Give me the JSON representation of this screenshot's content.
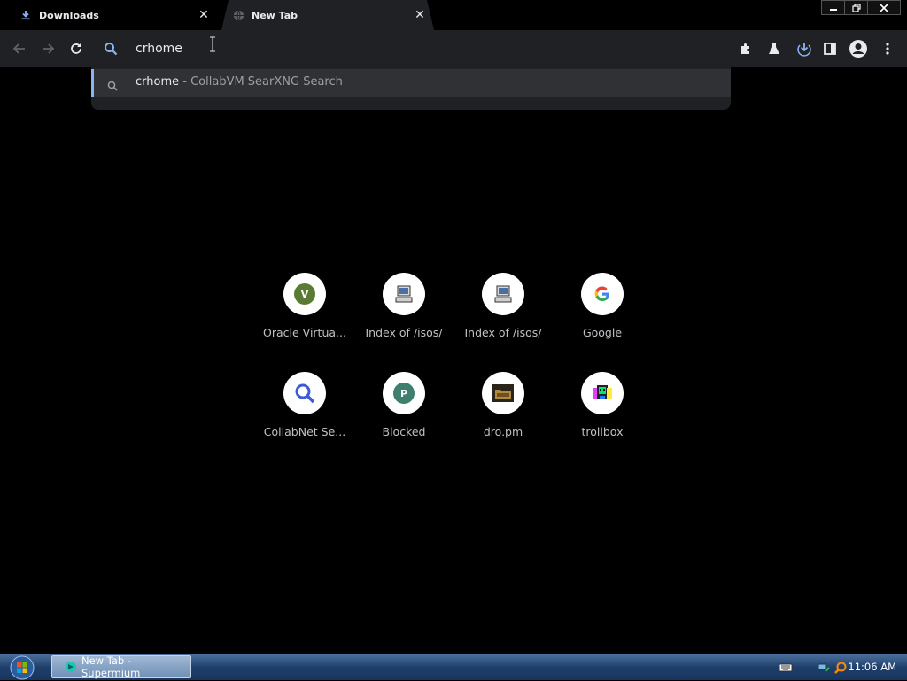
{
  "tabs": [
    {
      "title": "Downloads",
      "icon": "download-icon",
      "active": false
    },
    {
      "title": "New Tab",
      "icon": "globe-icon",
      "active": true
    }
  ],
  "omnibox": {
    "value": "crhome"
  },
  "suggestion": {
    "query": "crhome",
    "separator": " - ",
    "description": "CollabVM SearXNG Search"
  },
  "shortcuts": [
    {
      "label": "Oracle Virtua...",
      "icon": "v-letter-icon"
    },
    {
      "label": "Index of /isos/",
      "icon": "computer-icon"
    },
    {
      "label": "Index of /isos/",
      "icon": "computer-icon"
    },
    {
      "label": "Google",
      "icon": "google-icon"
    },
    {
      "label": "CollabNet Se...",
      "icon": "magnifier-icon"
    },
    {
      "label": "Blocked",
      "icon": "p-letter-icon"
    },
    {
      "label": "dro.pm",
      "icon": "dro-pm-icon"
    },
    {
      "label": "trollbox",
      "icon": "trollbox-icon"
    }
  ],
  "taskbar": {
    "task_label": "New Tab - Supermium",
    "clock": "11:06 AM"
  },
  "colors": {
    "accent": "#8ab4f8",
    "toolbar_bg": "#202124",
    "page_bg": "#000000"
  }
}
